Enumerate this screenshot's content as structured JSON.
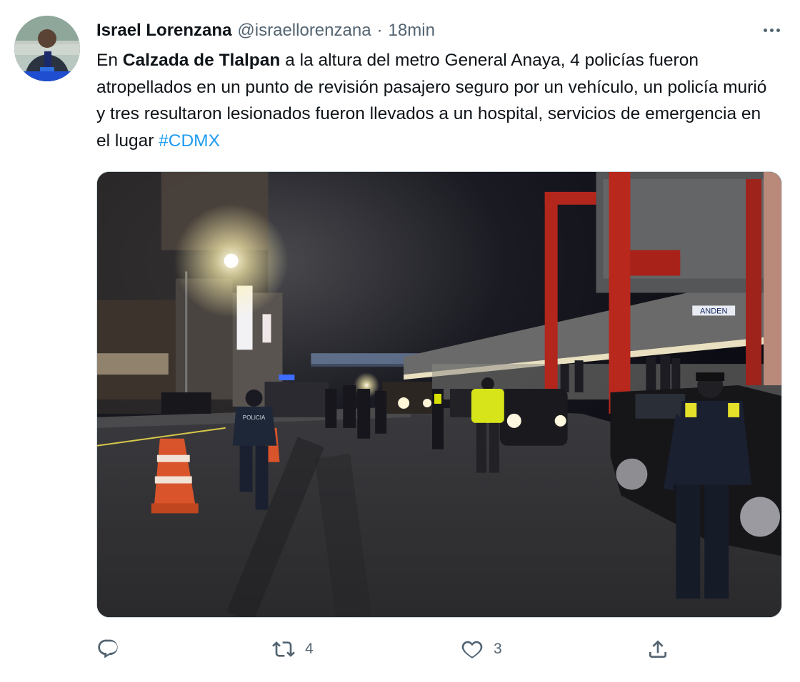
{
  "author": {
    "name": "Israel Lorenzana",
    "handle": "@israellorenzana",
    "separator": "·",
    "time": "18min"
  },
  "tweet": {
    "text_before": "En ",
    "text_bold": "Calzada de Tlalpan",
    "text_after": " a la altura del metro General Anaya, 4 policías fueron atropellados en un punto de revisión pasajero seguro por un vehículo, un policía murió y tres resultaron lesionados fueron llevados a un hospital, servicios de emergencia en el lugar ",
    "hashtag": "#CDMX"
  },
  "media": {
    "sign_text": "ANDEN",
    "vest_text": "POLICIA"
  },
  "actions": {
    "reply_count": "",
    "retweet_count": "4",
    "like_count": "3"
  },
  "icons": [
    "reply-icon",
    "retweet-icon",
    "like-icon",
    "share-icon",
    "more-options-icon"
  ],
  "colors": {
    "hashtag": "#1d9bf0",
    "secondary_text": "#536471",
    "border": "#cfd9de"
  }
}
